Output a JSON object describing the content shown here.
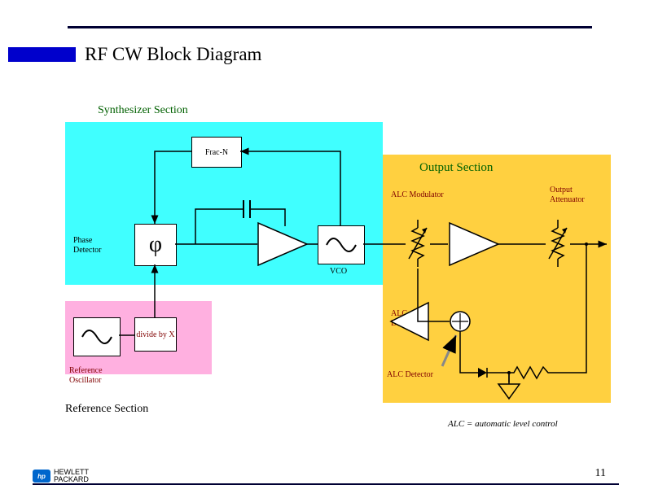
{
  "page": {
    "title": "RF CW Block Diagram",
    "number": "11",
    "footnote": "ALC = automatic level control"
  },
  "logo": {
    "badge": "hp",
    "line1": "HEWLETT",
    "line2": "PACKARD"
  },
  "sections": {
    "synth": "Synthesizer Section",
    "output": "Output Section",
    "ref": "Reference Section"
  },
  "blocks": {
    "fracn": "Frac-N",
    "phase": "Phase Detector",
    "phi": "φ",
    "vco": "VCO",
    "divx": "divide by X",
    "refosc": "Reference Oscillator",
    "alcmod": "ALC Modulator",
    "outatt": "Output Attenuator",
    "alcdrv": "ALC Driver",
    "alcdet": "ALC Detector"
  }
}
